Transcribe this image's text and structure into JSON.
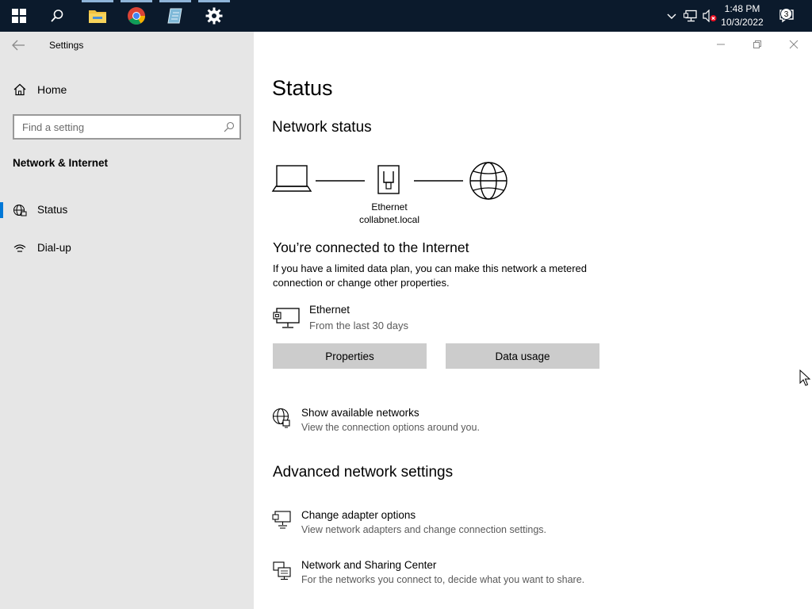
{
  "taskbar": {
    "time": "1:48 PM",
    "date": "10/3/2022",
    "notification_count": "3",
    "apps": [
      "windows-start",
      "search",
      "file-explorer",
      "chrome",
      "notepad",
      "settings"
    ]
  },
  "window": {
    "title": "Settings"
  },
  "sidebar": {
    "home_label": "Home",
    "search_placeholder": "Find a setting",
    "section_title": "Network & Internet",
    "items": [
      {
        "label": "Status",
        "icon": "globe-icon",
        "selected": true
      },
      {
        "label": "Dial-up",
        "icon": "dialup-icon",
        "selected": false
      }
    ]
  },
  "main": {
    "page_title": "Status",
    "network_status_heading": "Network status",
    "diagram": {
      "adapter_label": "Ethernet",
      "network_label": "collabnet.local"
    },
    "connected_heading": "You’re connected to the Internet",
    "connected_desc": "If you have a limited data plan, you can make this network a metered connection or change other properties.",
    "connection": {
      "name": "Ethernet",
      "sub": "From the last 30 days"
    },
    "buttons": {
      "properties": "Properties",
      "data_usage": "Data usage"
    },
    "show_networks": {
      "title": "Show available networks",
      "sub": "View the connection options around you."
    },
    "advanced_heading": "Advanced network settings",
    "adapter_options": {
      "title": "Change adapter options",
      "sub": "View network adapters and change connection settings."
    },
    "sharing_center": {
      "title": "Network and Sharing Center",
      "sub": "For the networks you connect to, decide what you want to share."
    }
  },
  "colors": {
    "accent": "#0078d7",
    "taskbar": "#0b1a2c",
    "sidebar": "#e6e6e6",
    "button": "#cccccc"
  }
}
